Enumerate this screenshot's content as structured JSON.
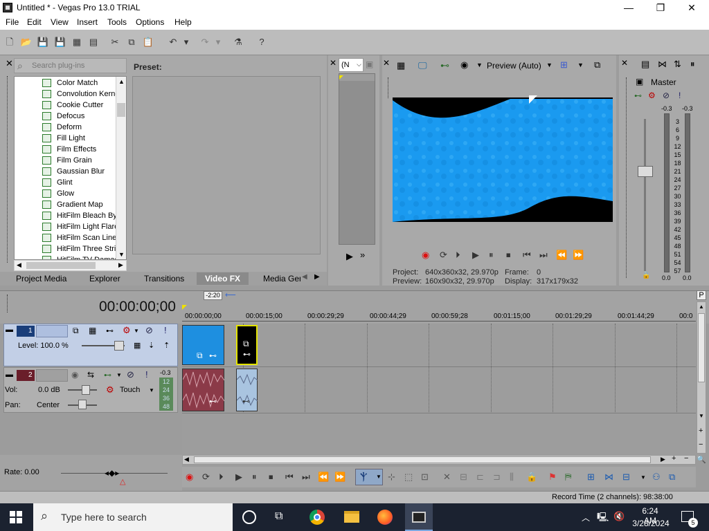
{
  "window": {
    "title": "Untitled * - Vegas Pro 13.0 TRIAL",
    "minimize": "—",
    "maximize": "❐",
    "close": "✕"
  },
  "menu": [
    "File",
    "Edit",
    "View",
    "Insert",
    "Tools",
    "Options",
    "Help"
  ],
  "plugins": {
    "search_placeholder": "Search plug-ins",
    "preset_label": "Preset:",
    "items": [
      "Color Match",
      "Convolution Kerne",
      "Cookie Cutter",
      "Defocus",
      "Deform",
      "Fill Light",
      "Film Effects",
      "Film Grain",
      "Gaussian Blur",
      "Glint",
      "Glow",
      "Gradient Map",
      "HitFilm Bleach Byp",
      "HitFilm Light Flares",
      "HitFilm Scan Lines",
      "HitFilm Three Strip",
      "HitFilm TV Damage"
    ]
  },
  "tabs": [
    "Project Media",
    "Explorer",
    "Transitions",
    "Video FX",
    "Media Gene"
  ],
  "active_tab": "Video FX",
  "trimmer": {
    "dropdown": "(N"
  },
  "preview": {
    "mode": "Preview (Auto)",
    "project_label": "Project:",
    "project_value": "640x360x32, 29.970p",
    "frame_label": "Frame:",
    "frame_value": "0",
    "preview_label": "Preview:",
    "preview_value": "160x90x32, 29.970p",
    "display_label": "Display:",
    "display_value": "317x179x32"
  },
  "master": {
    "title": "Master",
    "peak_left": "-0.3",
    "peak_right": "-0.3",
    "scale": [
      "3",
      "6",
      "9",
      "12",
      "15",
      "18",
      "21",
      "24",
      "27",
      "30",
      "33",
      "36",
      "39",
      "42",
      "45",
      "48",
      "51",
      "54",
      "57"
    ],
    "bottom_left": "0.0",
    "bottom_right": "0.0"
  },
  "timeline": {
    "timecode": "00:00:00;00",
    "marker": "-2:20",
    "ruler": [
      "00:00:00;00",
      "00:00:15;00",
      "00:00:29;29",
      "00:00:44;29",
      "00:00:59;28",
      "00:01:15;00",
      "00:01:29;29",
      "00:01:44;29",
      "00:0"
    ]
  },
  "track1": {
    "number": "1",
    "level": "Level: 100.0 %"
  },
  "track2": {
    "number": "2",
    "vol_label": "Vol:",
    "vol_value": "0.0 dB",
    "pan_label": "Pan:",
    "pan_value": "Center",
    "mode": "Touch",
    "meter_top": "-0.3",
    "meter_scale": [
      "12",
      "24",
      "36",
      "48"
    ]
  },
  "rate": "Rate: 0.00",
  "status": "Record Time (2 channels): 98:38:00",
  "taskbar": {
    "search_placeholder": "Type here to search",
    "time": "6:24 AM",
    "date": "3/28/2024",
    "notifications": "5"
  },
  "colors": {
    "track1_header": "#c2cfe6",
    "video_clip": "#1e8fe0",
    "audio_clip": "#8b3a48",
    "taskbar": "#1b2230"
  }
}
